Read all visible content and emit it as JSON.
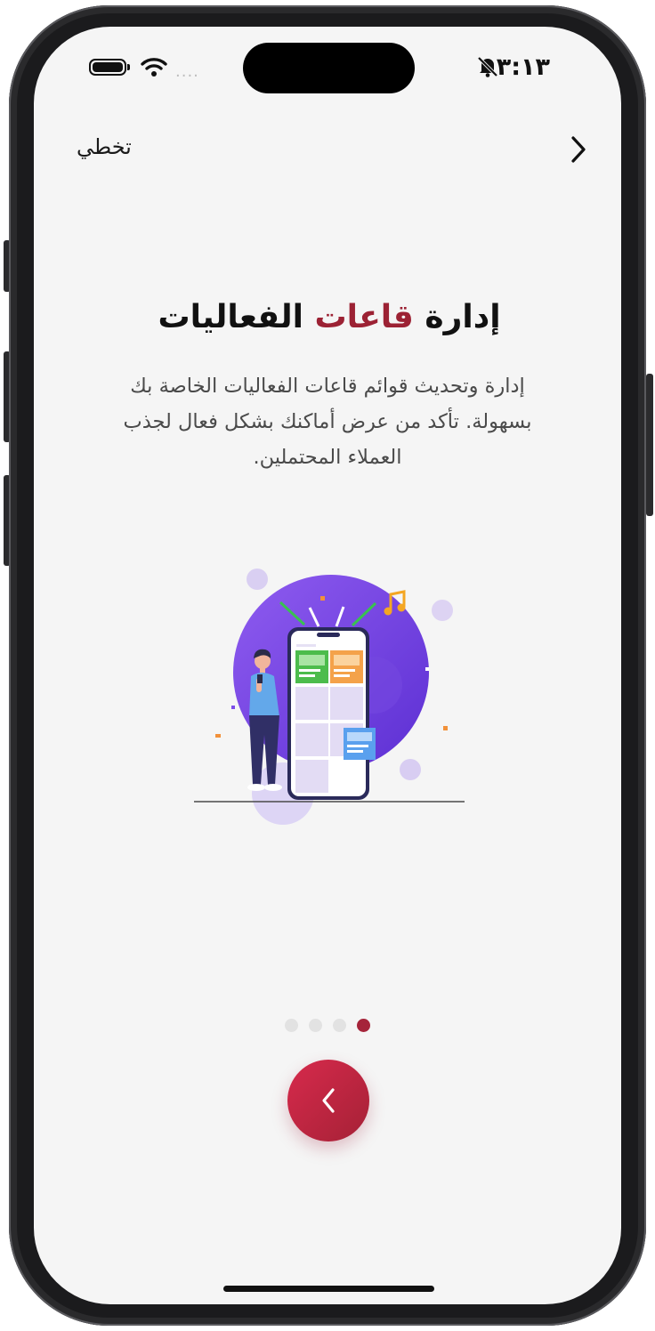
{
  "status_bar": {
    "time": "٣:١٣",
    "signal_dots": "....",
    "icons": [
      "battery-icon",
      "wifi-icon",
      "bell-slash-icon"
    ]
  },
  "nav": {
    "skip_label": "تخطي",
    "forward_icon": "chevron-right-icon"
  },
  "content": {
    "title_part1": "إدارة",
    "title_accent": "قاعات",
    "title_part2": "الفعاليات",
    "description": "إدارة وتحديث قوائم قاعات الفعاليات الخاصة بك بسهولة. تأكد من عرض أماكنك بشكل فعال لجذب العملاء المحتملين.",
    "illustration": "person-with-phone-illustration"
  },
  "pager": {
    "count": 4,
    "active_index": 3
  },
  "actions": {
    "next_icon": "chevron-left-icon"
  },
  "colors": {
    "accent": "#9c2234",
    "button": "#c8223f",
    "background": "#f5f5f5",
    "illustration_purple": "#6f3ce4"
  }
}
